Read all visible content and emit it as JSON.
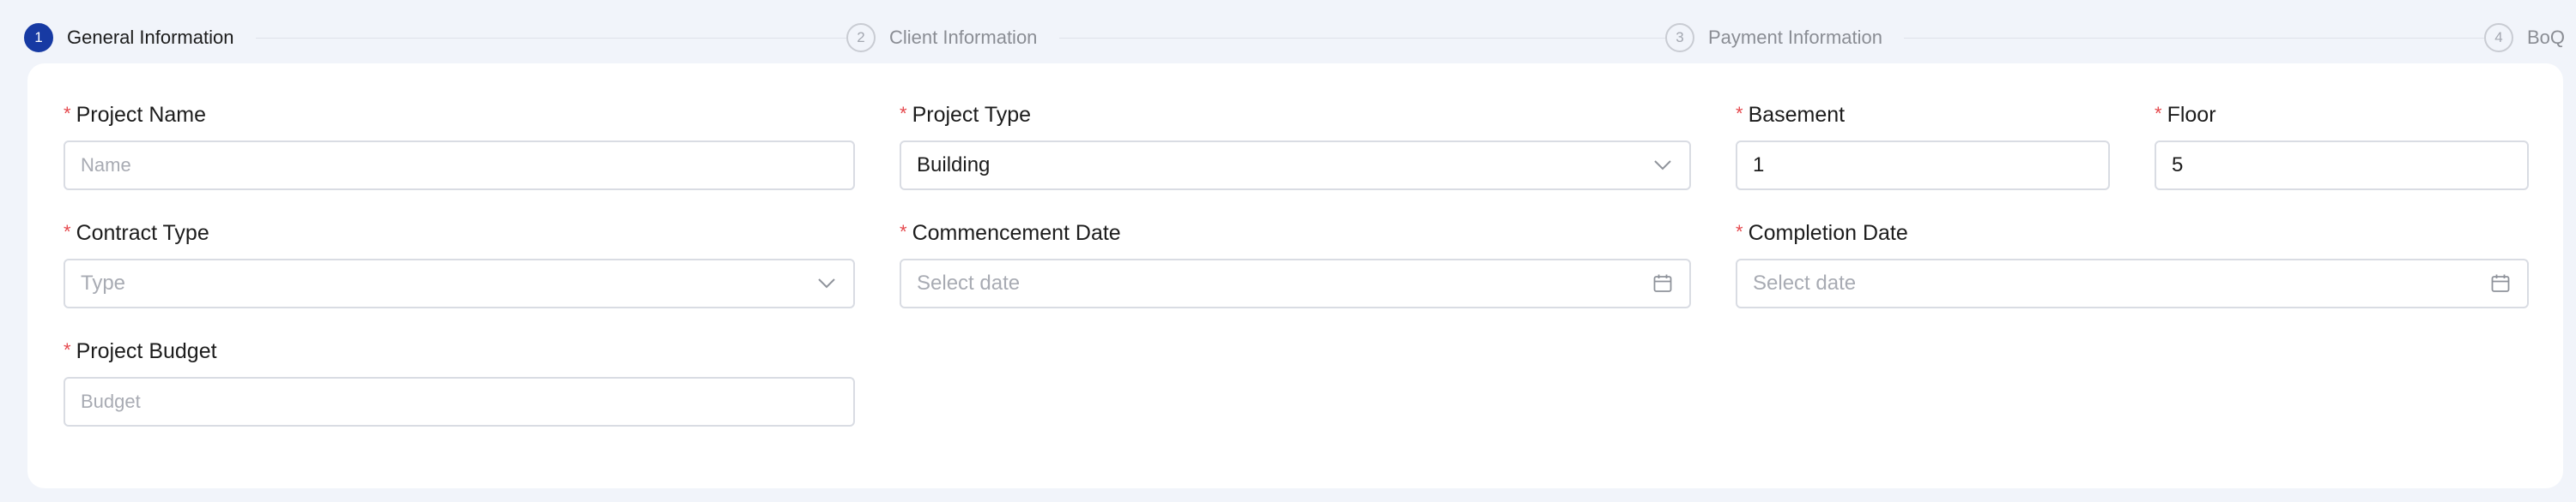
{
  "steps": [
    {
      "number": "1",
      "label": "General Information",
      "active": true
    },
    {
      "number": "2",
      "label": "Client Information",
      "active": false
    },
    {
      "number": "3",
      "label": "Payment Information",
      "active": false
    },
    {
      "number": "4",
      "label": "BoQ",
      "active": false
    }
  ],
  "form": {
    "required_marker": "*",
    "project_name": {
      "label": "Project Name",
      "placeholder": "Name",
      "value": ""
    },
    "project_type": {
      "label": "Project Type",
      "value": "Building",
      "icon": "chevron-down-icon"
    },
    "basement": {
      "label": "Basement",
      "value": "1"
    },
    "floor": {
      "label": "Floor",
      "value": "5"
    },
    "contract_type": {
      "label": "Contract Type",
      "placeholder": "Type",
      "icon": "chevron-down-icon"
    },
    "commencement_date": {
      "label": "Commencement Date",
      "placeholder": "Select date",
      "icon": "calendar-icon"
    },
    "completion_date": {
      "label": "Completion Date",
      "placeholder": "Select date",
      "icon": "calendar-icon"
    },
    "project_budget": {
      "label": "Project Budget",
      "placeholder": "Budget",
      "value": ""
    }
  },
  "colors": {
    "accent": "#173aa3",
    "required": "#e5484d",
    "background": "#f1f4fa",
    "border": "#d9dce3",
    "placeholder": "#a8abb3"
  }
}
